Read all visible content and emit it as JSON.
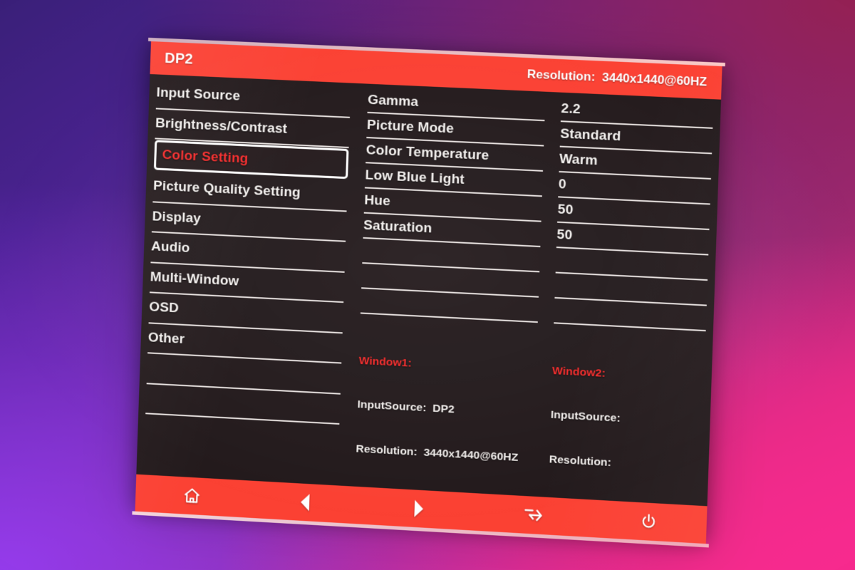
{
  "colors": {
    "accent_red": "#f74235",
    "highlight_text_red": "#ef2b2b",
    "panel_background": "#231a1c",
    "rule_white": "#e8e2e0",
    "text_white": "#f4f1ef",
    "backdrop_purple": "#3a2079",
    "backdrop_pink": "#f72a8e"
  },
  "titlebar": {
    "input_source": "DP2",
    "resolution_label": "Resolution:",
    "resolution_value": "3440x1440@60HZ"
  },
  "menu": {
    "items": [
      {
        "label": "Input Source",
        "selected": false
      },
      {
        "label": "Brightness/Contrast",
        "selected": false
      },
      {
        "label": "Color Setting",
        "selected": true
      },
      {
        "label": "Picture Quality Setting",
        "selected": false
      },
      {
        "label": "Display",
        "selected": false
      },
      {
        "label": "Audio",
        "selected": false
      },
      {
        "label": "Multi-Window",
        "selected": false
      },
      {
        "label": "OSD",
        "selected": false
      },
      {
        "label": "Other",
        "selected": false
      }
    ],
    "empty_rows": 2
  },
  "submenu": {
    "items": [
      {
        "label": "Gamma",
        "value": "2.2"
      },
      {
        "label": "Picture Mode",
        "value": "Standard"
      },
      {
        "label": "Color Temperature",
        "value": "Warm"
      },
      {
        "label": "Low Blue Light",
        "value": "0"
      },
      {
        "label": "Hue",
        "value": "50"
      },
      {
        "label": "Saturation",
        "value": "50"
      }
    ],
    "empty_rows": 3
  },
  "window_info": {
    "window1": {
      "title": "Window1:",
      "input_source_label": "InputSource:",
      "input_source_value": "DP2",
      "resolution_label": "Resolution:",
      "resolution_value": "3440x1440@60HZ"
    },
    "window2": {
      "title": "Window2:",
      "input_source_label": "InputSource:",
      "input_source_value": "",
      "resolution_label": "Resolution:",
      "resolution_value": ""
    }
  },
  "toolbar": {
    "buttons": [
      {
        "icon": "home-icon",
        "label": "Home"
      },
      {
        "icon": "arrow-left-icon",
        "label": "Left"
      },
      {
        "icon": "arrow-right-icon",
        "label": "Right"
      },
      {
        "icon": "exit-icon",
        "label": "Exit"
      },
      {
        "icon": "power-icon",
        "label": "Power"
      }
    ]
  }
}
